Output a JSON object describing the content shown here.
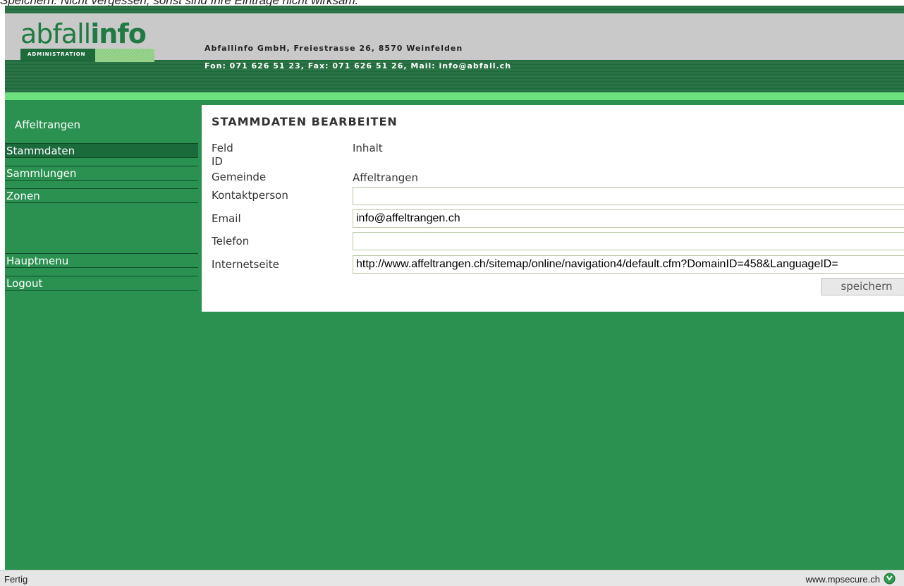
{
  "caption": "Speichern: Nicht vergessen, sonst sind Ihre Einträge nicht wirksam.",
  "header": {
    "logo_part1": "abfall",
    "logo_part2": "info",
    "logo_sub": "ADMINISTRATION",
    "company": "Abfallinfo GmbH, Freiestrasse 26, 8570 Weinfelden",
    "contact": "Fon: 071 626 51 23, Fax: 071 626 51 26, Mail: info@abfall.ch"
  },
  "sidebar": {
    "title": "Affeltrangen",
    "items": [
      {
        "label": "Stammdaten"
      },
      {
        "label": "Sammlungen"
      },
      {
        "label": "Zonen"
      },
      {
        "label": "Hauptmenu"
      },
      {
        "label": "Logout"
      }
    ]
  },
  "form": {
    "title": "STAMMDATEN BEARBEITEN",
    "col_field": "Feld",
    "col_content": "Inhalt",
    "id_label": "ID",
    "gemeinde_label": "Gemeinde",
    "gemeinde_value": "Affeltrangen",
    "kontakt_label": "Kontaktperson",
    "kontakt_value": "",
    "email_label": "Email",
    "email_value": "info@affeltrangen.ch",
    "telefon_label": "Telefon",
    "telefon_value": "",
    "internet_label": "Internetseite",
    "internet_value": "http://www.affeltrangen.ch/sitemap/online/navigation4/default.cfm?DomainID=458&LanguageID=",
    "save_label": "speichern"
  },
  "status": {
    "left": "Fertig",
    "right": "www.mpsecure.ch",
    "icon": "secure-site-icon"
  },
  "colors": {
    "green": "#2a9151",
    "dark_green": "#1e6a3b",
    "accent_green": "#6ee17f",
    "gray": "#c9c9c9"
  }
}
